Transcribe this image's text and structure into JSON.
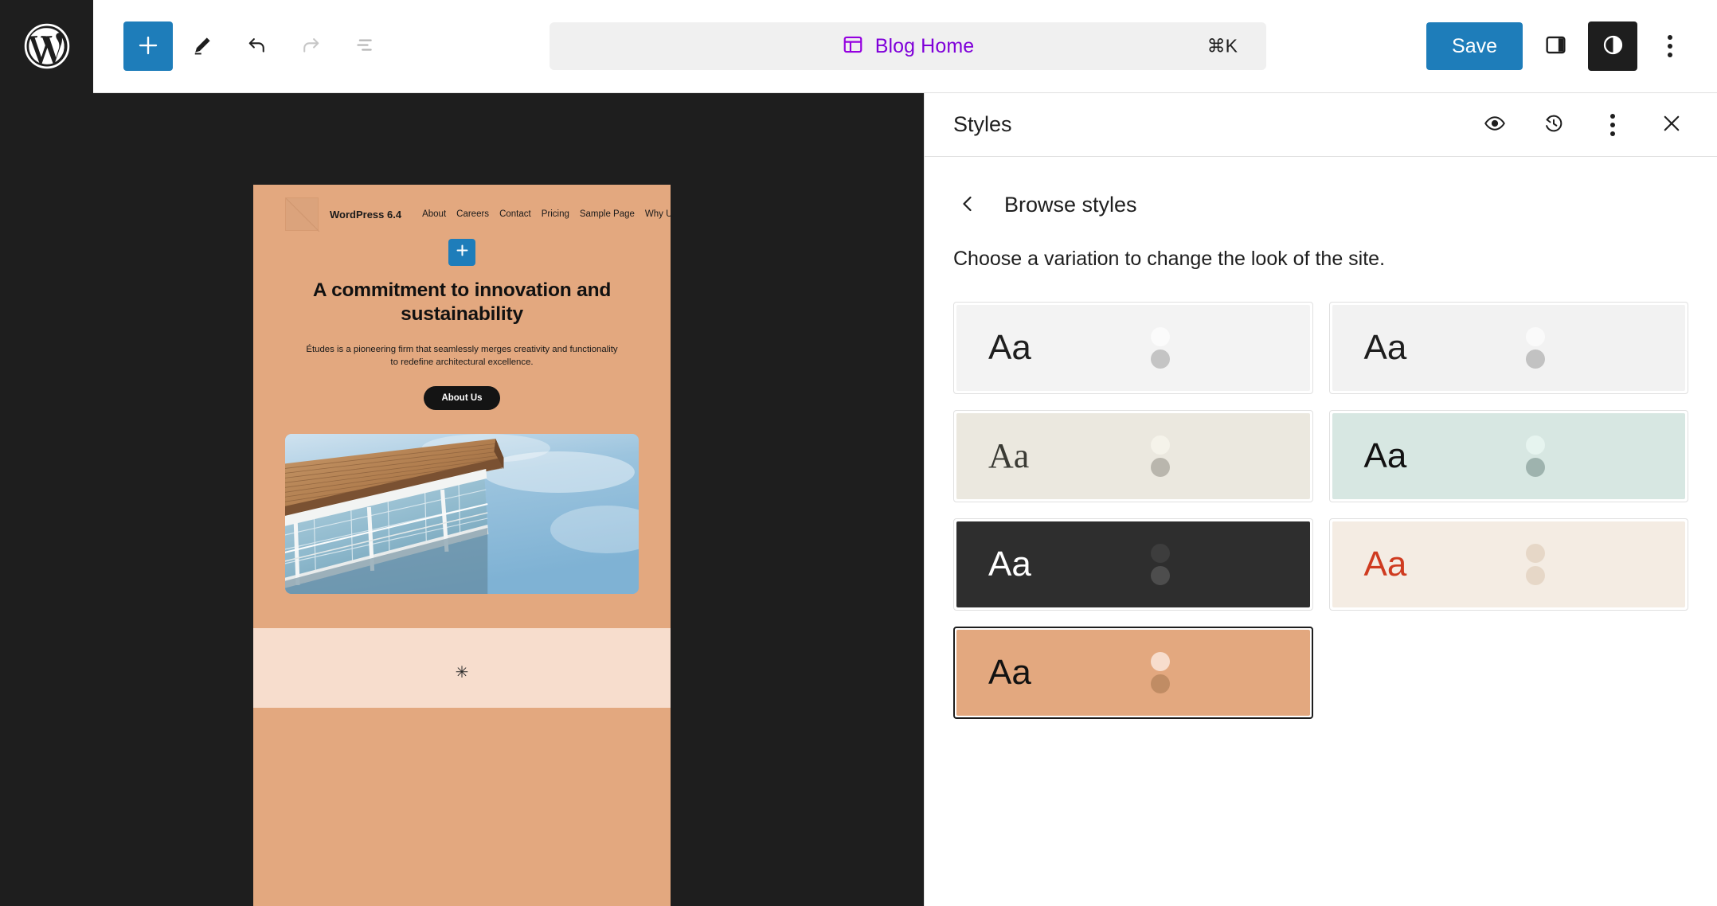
{
  "app": {
    "logo_icon": "wordpress-logo-icon"
  },
  "toolbar": {
    "add_block_label": "+",
    "tools": [
      {
        "name": "add-block-button",
        "icon": "plus-icon"
      },
      {
        "name": "edit-tool-button",
        "icon": "pencil-icon"
      },
      {
        "name": "undo-button",
        "icon": "undo-icon"
      },
      {
        "name": "redo-button",
        "icon": "redo-icon"
      },
      {
        "name": "list-view-button",
        "icon": "list-view-icon"
      }
    ],
    "command_bar": {
      "icon": "template-layout-icon",
      "title": "Blog Home",
      "shortcut": "⌘K"
    },
    "save_label": "Save",
    "settings_icon": "sidebar-panel-icon",
    "styles_icon": "styles-contrast-icon",
    "options_icon": "more-options-icon"
  },
  "styles_panel": {
    "title": "Styles",
    "header_actions": [
      {
        "name": "style-book-button",
        "icon": "eye-icon"
      },
      {
        "name": "revisions-button",
        "icon": "revision-history-icon"
      },
      {
        "name": "styles-more-menu-button",
        "icon": "more-options-icon"
      },
      {
        "name": "close-styles-button",
        "icon": "close-icon"
      }
    ],
    "back_icon": "chevron-left-icon",
    "nav_title": "Browse styles",
    "description": "Choose a variation to change the look of the site.",
    "variations": [
      {
        "label": "Aa",
        "bg": "#f3f3f3",
        "text": "#1e1e1e",
        "font": "sans",
        "swatch_top": "#fbfbfb",
        "swatch_bottom": "#c4c4c4",
        "selected": false
      },
      {
        "label": "Aa",
        "bg": "#f2f2f2",
        "text": "#1e1e1e",
        "font": "sans",
        "swatch_top": "#fafafa",
        "swatch_bottom": "#c2c2c2",
        "selected": false
      },
      {
        "label": "Aa",
        "bg": "#ebe8df",
        "text": "#3a3a34",
        "font": "serif",
        "swatch_top": "#f5f3ea",
        "swatch_bottom": "#b9b6ad",
        "selected": false
      },
      {
        "label": "Aa",
        "bg": "#d7e7e2",
        "text": "#121212",
        "font": "sans",
        "swatch_top": "#e6f4ef",
        "swatch_bottom": "#9eb3ae",
        "selected": false
      },
      {
        "label": "Aa",
        "bg": "#2e2e2e",
        "text": "#ffffff",
        "font": "sans",
        "swatch_top": "#3d3d3d",
        "swatch_bottom": "#4d4d4d",
        "selected": false
      },
      {
        "label": "Aa",
        "bg": "#f4ece3",
        "text": "#cf3b20",
        "font": "sans",
        "swatch_top": "#e6d7c7",
        "swatch_bottom": "#e6d7c7",
        "selected": false
      },
      {
        "label": "Aa",
        "bg": "#e3a87f",
        "text": "#121212",
        "font": "sans",
        "swatch_top": "#f7ddcd",
        "swatch_bottom": "#c08c64",
        "selected": true
      }
    ]
  },
  "site_preview": {
    "logo_icon": "site-logo-placeholder-icon",
    "site_title": "WordPress 6.4",
    "nav_items": [
      "About",
      "Careers",
      "Contact",
      "Pricing",
      "Sample Page",
      "Why Us"
    ],
    "inserter_icon": "plus-icon",
    "heading": "A commitment to innovation and sustainability",
    "paragraph": "Études is a pioneering firm that seamlessly merges creativity and functionality to redefine architectural excellence.",
    "cta_label": "About Us",
    "hero_image_alt": "architectural-building-photo",
    "divider_glyph": "✳",
    "colors": {
      "background": "#e3a87f",
      "section_two_background": "#f7ddcd",
      "button_background": "#141414",
      "text": "#121212"
    }
  }
}
